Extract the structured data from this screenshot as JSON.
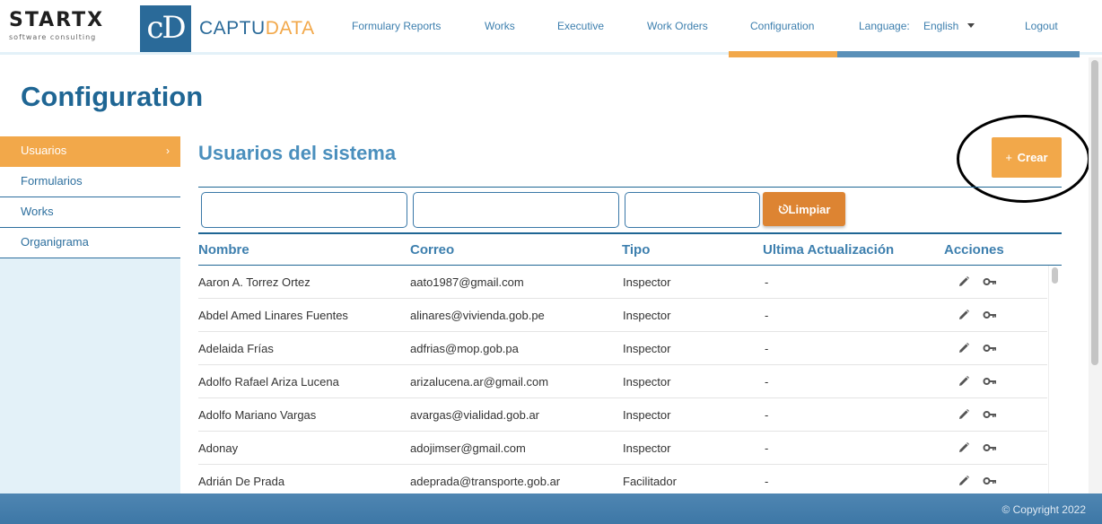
{
  "brand": {
    "company": "STARTX",
    "company_tagline": "software consulting",
    "logo_mark": "cD",
    "product_part1": "CAPTU",
    "product_part2": "DATA"
  },
  "nav": {
    "items": [
      {
        "label": "Formulary Reports"
      },
      {
        "label": "Works"
      },
      {
        "label": "Executive"
      },
      {
        "label": "Work Orders"
      },
      {
        "label": "Configuration"
      }
    ],
    "language_label": "Language:",
    "language_value": "English",
    "logout": "Logout"
  },
  "page": {
    "title": "Configuration"
  },
  "sidebar": {
    "items": [
      {
        "label": "Usuarios",
        "active": true
      },
      {
        "label": "Formularios"
      },
      {
        "label": "Works"
      },
      {
        "label": "Organigrama"
      }
    ]
  },
  "main": {
    "section_title": "Usuarios del sistema",
    "create_plus": "+",
    "create_label": "Crear",
    "clear_label": "Limpiar",
    "filters": [
      {
        "value": "",
        "placeholder": ""
      },
      {
        "value": "",
        "placeholder": ""
      },
      {
        "value": "",
        "placeholder": ""
      }
    ],
    "columns": [
      "Nombre",
      "Correo",
      "Tipo",
      "Ultima Actualización",
      "Acciones"
    ],
    "rows": [
      {
        "nombre": "Aaron A. Torrez Ortez",
        "correo": "aato1987@gmail.com",
        "tipo": "Inspector",
        "ultima": "-"
      },
      {
        "nombre": "Abdel Amed Linares Fuentes",
        "correo": "alinares@vivienda.gob.pe",
        "tipo": "Inspector",
        "ultima": "-"
      },
      {
        "nombre": "Adelaida Frías",
        "correo": "adfrias@mop.gob.pa",
        "tipo": "Inspector",
        "ultima": "-"
      },
      {
        "nombre": "Adolfo Rafael Ariza Lucena",
        "correo": "arizalucena.ar@gmail.com",
        "tipo": "Inspector",
        "ultima": "-"
      },
      {
        "nombre": "Adolfo Mariano Vargas",
        "correo": "avargas@vialidad.gob.ar",
        "tipo": "Inspector",
        "ultima": "-"
      },
      {
        "nombre": "Adonay",
        "correo": "adojimser@gmail.com",
        "tipo": "Inspector",
        "ultima": "-"
      },
      {
        "nombre": "Adrián De Prada",
        "correo": "adeprada@transporte.gob.ar",
        "tipo": "Facilitador",
        "ultima": "-"
      }
    ]
  },
  "footer": {
    "copyright": "© Copyright 2022"
  },
  "icons": {
    "edit": "pencil-icon",
    "password": "key-icon",
    "clear": "reset-icon",
    "chevron": "chevron-right-icon"
  },
  "colors": {
    "primary": "#1f6694",
    "accent": "#f2a84a",
    "clear_button": "#dd8432",
    "footer": "#4a82ae"
  }
}
